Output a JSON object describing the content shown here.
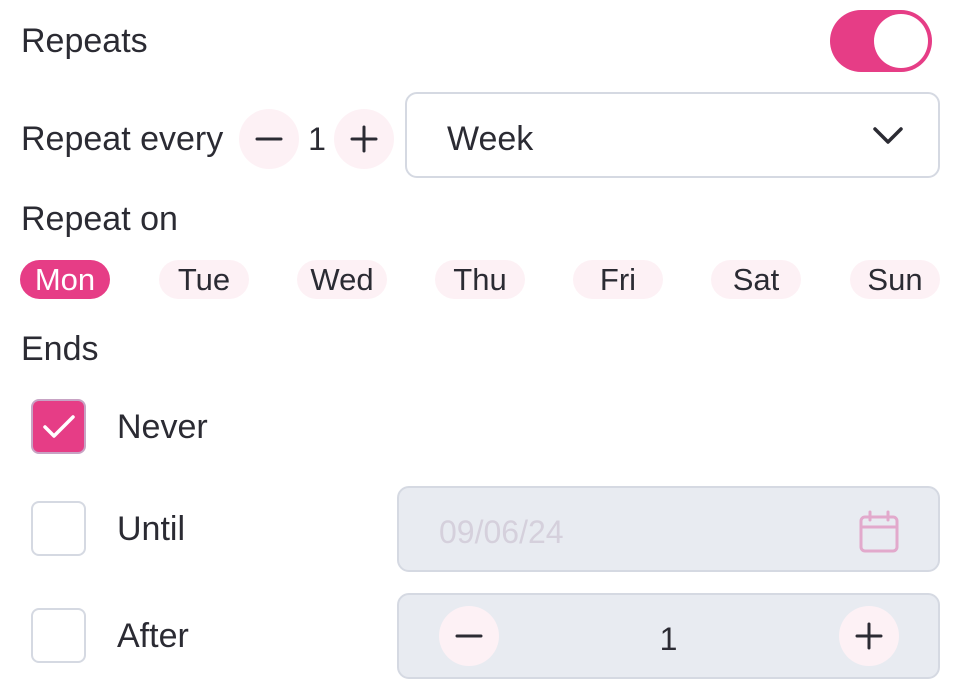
{
  "repeats": {
    "label": "Repeats",
    "enabled": true
  },
  "repeat_every": {
    "label": "Repeat every",
    "count": "1",
    "decrement_icon": "minus-icon",
    "increment_icon": "plus-icon",
    "unit": {
      "value": "Week",
      "icon": "chevron-down-icon"
    }
  },
  "repeat_on": {
    "label": "Repeat on",
    "days": [
      {
        "label": "Mon",
        "selected": true
      },
      {
        "label": "Tue",
        "selected": false
      },
      {
        "label": "Wed",
        "selected": false
      },
      {
        "label": "Thu",
        "selected": false
      },
      {
        "label": "Fri",
        "selected": false
      },
      {
        "label": "Sat",
        "selected": false
      },
      {
        "label": "Sun",
        "selected": false
      }
    ]
  },
  "ends": {
    "label": "Ends",
    "options": {
      "never": {
        "label": "Never",
        "checked": true
      },
      "until": {
        "label": "Until",
        "checked": false,
        "date_placeholder": "09/06/24",
        "icon": "calendar-icon"
      },
      "after": {
        "label": "After",
        "checked": false,
        "count": "1"
      }
    }
  },
  "colors": {
    "accent": "#e63d86",
    "accent_light": "#fdf1f5",
    "disabled_field": "#e8ebf1",
    "border": "#d5d9e2"
  }
}
